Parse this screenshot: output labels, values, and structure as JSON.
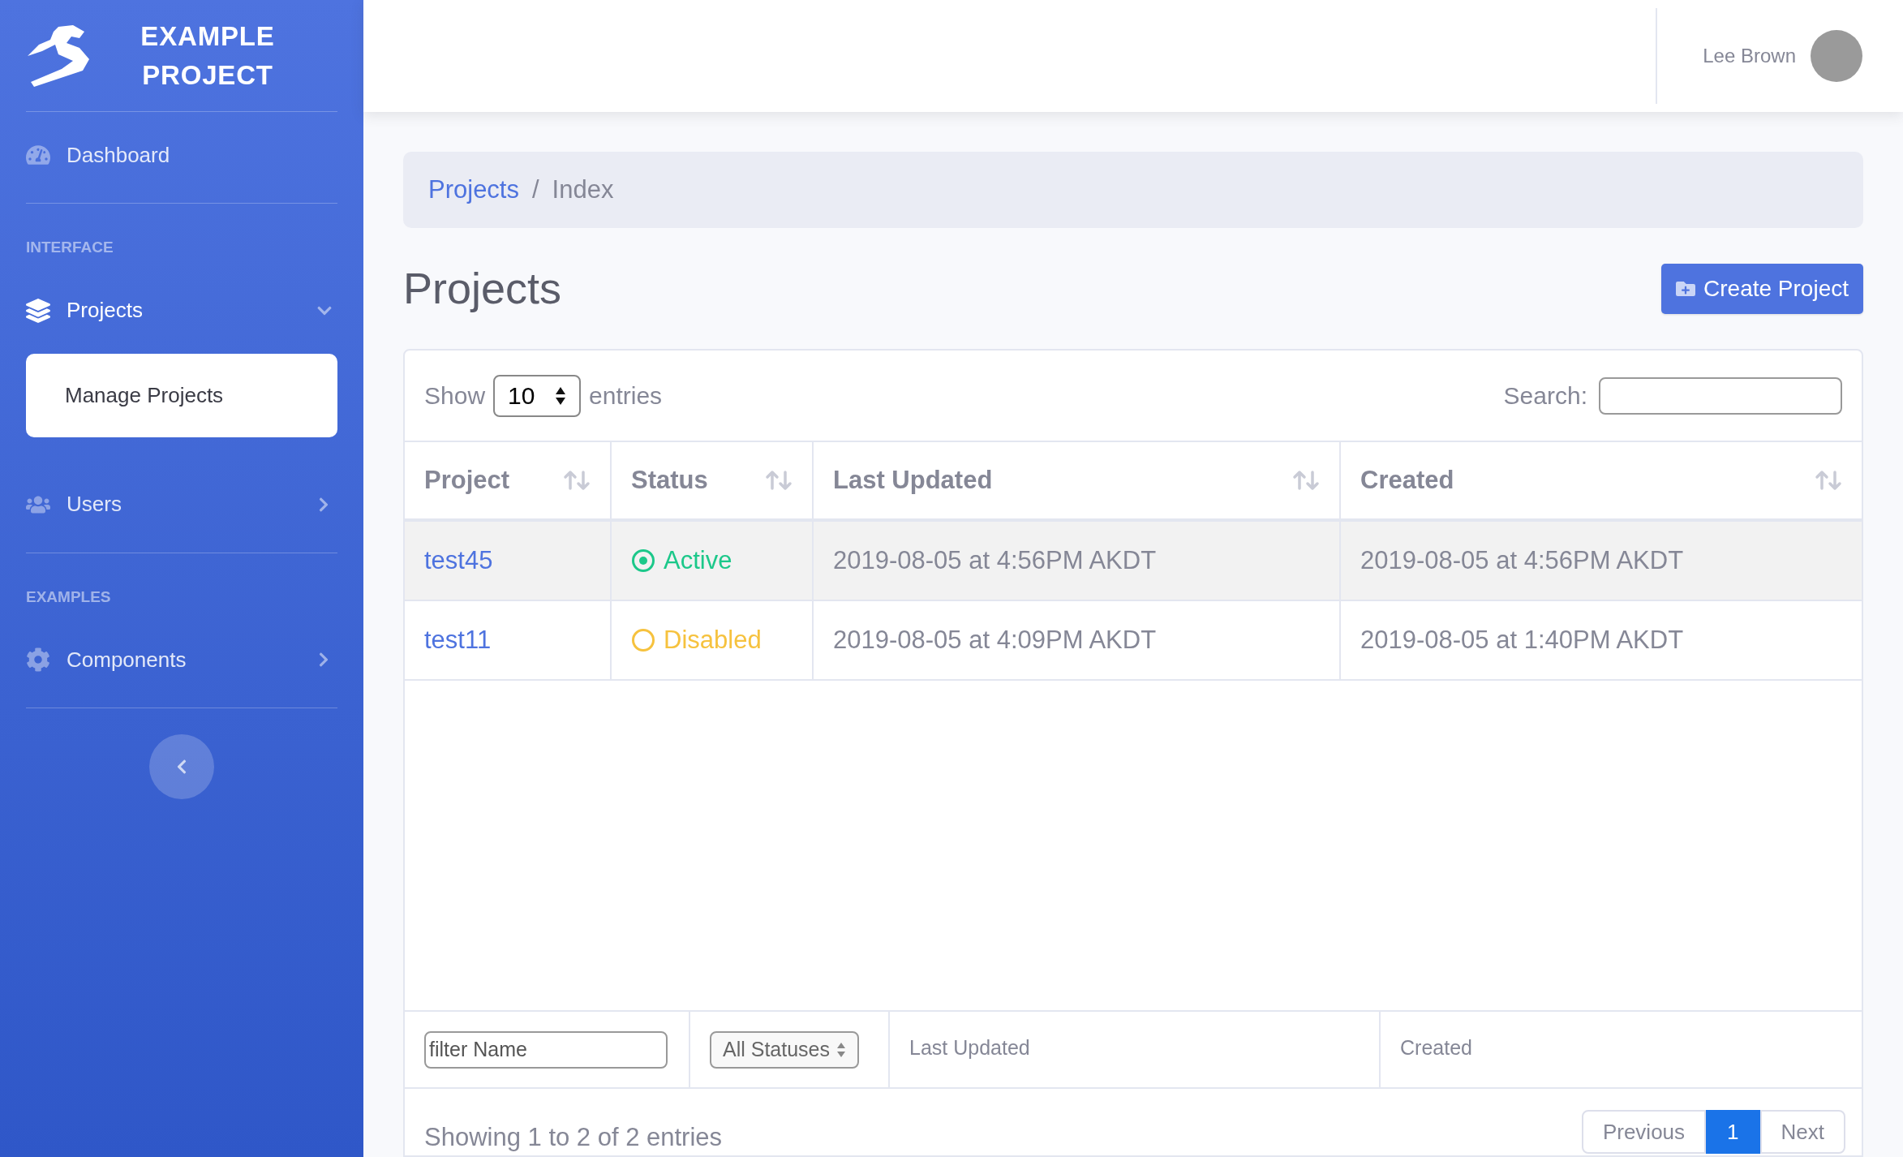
{
  "brand": {
    "title": "EXAMPLE PROJECT"
  },
  "sidebar": {
    "groups": [
      {
        "items": [
          {
            "label": "Dashboard",
            "kind": "link"
          }
        ]
      },
      {
        "heading": "INTERFACE",
        "items": [
          {
            "label": "Projects",
            "kind": "menu",
            "expanded": true,
            "children": [
              {
                "label": "Manage Projects",
                "selected": true
              }
            ]
          },
          {
            "label": "Users",
            "kind": "menu",
            "expanded": false
          }
        ]
      },
      {
        "heading": "EXAMPLES",
        "items": [
          {
            "label": "Components",
            "kind": "menu",
            "expanded": false
          }
        ]
      }
    ]
  },
  "topbar": {
    "user_name": "Lee Brown"
  },
  "breadcrumb": {
    "separator": "/",
    "items": [
      {
        "label": "Projects",
        "kind": "link"
      },
      {
        "label": "Index",
        "kind": "current"
      }
    ]
  },
  "page_title": "Projects",
  "create_button": "Create Project",
  "table": {
    "length_label_before": "Show",
    "length_value": "10",
    "length_label_after": "entries",
    "search_label": "Search:",
    "columns": [
      "Project",
      "Status",
      "Last Updated",
      "Created"
    ],
    "rows": [
      {
        "selected": true,
        "project": "test45",
        "status": {
          "kind": "active",
          "label": "Active",
          "color": "#1cc88a"
        },
        "last_updated": "2019-08-05 at 4:56PM AKDT",
        "created": "2019-08-05 at 4:56PM AKDT"
      },
      {
        "selected": false,
        "project": "test11",
        "status": {
          "kind": "disabled",
          "label": "Disabled",
          "color": "#f6c23e"
        },
        "last_updated": "2019-08-05 at 4:09PM AKDT",
        "created": "2019-08-05 at 1:40PM AKDT"
      }
    ],
    "filters": {
      "name_placeholder": "filter Name",
      "status_value": "All Statuses",
      "last_updated": "Last Updated",
      "created": "Created"
    },
    "info": "Showing 1 to 2 of 2 entries",
    "pagination": [
      {
        "label": "Previous",
        "selected": false
      },
      {
        "label": "1",
        "selected": true
      },
      {
        "label": "Next",
        "selected": false
      }
    ]
  }
}
